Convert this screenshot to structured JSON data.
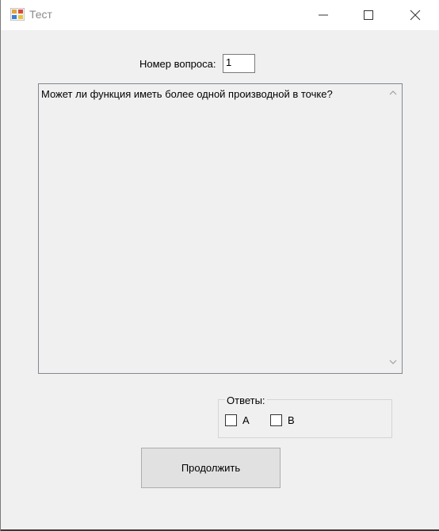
{
  "window": {
    "title": "Тест",
    "icon": "app-form-icon",
    "controls": [
      "minimize-icon",
      "maximize-icon",
      "close-icon"
    ]
  },
  "question_number": {
    "label": "Номер вопроса:",
    "value": "1"
  },
  "question": {
    "text": "Может ли функция иметь более одной производной в точке?"
  },
  "answers": {
    "legend": "Ответы:",
    "options": [
      {
        "label": "A",
        "checked": false
      },
      {
        "label": "B",
        "checked": false
      }
    ]
  },
  "continue_button": {
    "label": "Продолжить"
  }
}
